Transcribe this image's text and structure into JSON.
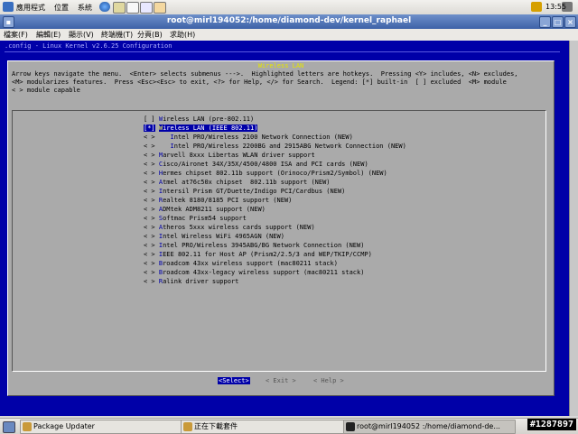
{
  "top_panel": {
    "menus": [
      "應用程式",
      "位置",
      "系統"
    ],
    "clock": "13:55"
  },
  "window": {
    "title": "root@mirl194052:/home/diamond-dev/kernel_raphael"
  },
  "menubar": {
    "items": [
      "檔案(F)",
      "編輯(E)",
      "顯示(V)",
      "終端機(T)",
      "分頁(B)",
      "求助(H)"
    ]
  },
  "terminal": {
    "header": ".config - Linux Kernel v2.6.25 Configuration"
  },
  "dialog": {
    "title": "Wireless LAN",
    "help_lines": [
      "Arrow keys navigate the menu.  <Enter> selects submenus --->.  Highlighted letters are hotkeys.  Pressing <Y> includes, <N> excludes,",
      "<M> modularizes features.  Press <Esc><Esc> to exit, <?> for Help, </> for Search.  Legend: [*] built-in  [ ] excluded  <M> module",
      "< > module capable"
    ],
    "items": [
      {
        "mark": "[ ]",
        "hot": "W",
        "rest": "ireless LAN (pre-802.11)",
        "selected": false
      },
      {
        "mark": "[*]",
        "hot": "W",
        "rest": "ireless LAN (IEEE 802.11)",
        "selected": true
      },
      {
        "mark": "< >",
        "hot": "I",
        "rest": "ntel PRO/Wireless 2100 Network Connection (NEW)",
        "selected": false,
        "indent": true
      },
      {
        "mark": "< >",
        "hot": "I",
        "rest": "ntel PRO/Wireless 2200BG and 2915ABG Network Connection (NEW)",
        "selected": false,
        "indent": true
      },
      {
        "mark": "< >",
        "hot": "M",
        "rest": "arvell 8xxx Libertas WLAN driver support",
        "selected": false
      },
      {
        "mark": "< >",
        "hot": "C",
        "rest": "isco/Aironet 34X/35X/4500/4800 ISA and PCI cards (NEW)",
        "selected": false
      },
      {
        "mark": "< >",
        "hot": "H",
        "rest": "ermes chipset 802.11b support (Orinoco/Prism2/Symbol) (NEW)",
        "selected": false
      },
      {
        "mark": "< >",
        "hot": "A",
        "rest": "tmel at76c50x chipset  802.11b support (NEW)",
        "selected": false
      },
      {
        "mark": "< >",
        "hot": "I",
        "rest": "ntersil Prism GT/Duette/Indigo PCI/Cardbus (NEW)",
        "selected": false
      },
      {
        "mark": "< >",
        "hot": "R",
        "rest": "ealtek 8180/8185 PCI support (NEW)",
        "selected": false
      },
      {
        "mark": "< >",
        "hot": "A",
        "rest": "DMtek ADM8211 support (NEW)",
        "selected": false
      },
      {
        "mark": "< >",
        "hot": "S",
        "rest": "oftmac Prism54 support",
        "selected": false
      },
      {
        "mark": "< >",
        "hot": "A",
        "rest": "theros 5xxx wireless cards support (NEW)",
        "selected": false
      },
      {
        "mark": "< >",
        "hot": "I",
        "rest": "ntel Wireless WiFi 4965AGN (NEW)",
        "selected": false
      },
      {
        "mark": "< >",
        "hot": "I",
        "rest": "ntel PRO/Wireless 3945ABG/BG Network Connection (NEW)",
        "selected": false
      },
      {
        "mark": "< >",
        "hot": "I",
        "rest": "EEE 802.11 for Host AP (Prism2/2.5/3 and WEP/TKIP/CCMP)",
        "selected": false
      },
      {
        "mark": "< >",
        "hot": "B",
        "rest": "roadcom 43xx wireless support (mac80211 stack)",
        "selected": false
      },
      {
        "mark": "< >",
        "hot": "B",
        "rest": "roadcom 43xx-legacy wireless support (mac80211 stack)",
        "selected": false
      },
      {
        "mark": "< >",
        "hot": "R",
        "rest": "alink driver support",
        "selected": false
      }
    ],
    "buttons": {
      "select": "<Select>",
      "exit": "< Exit >",
      "help": "< Help >"
    }
  },
  "taskbar": {
    "tasks": [
      {
        "label": "Package Updater",
        "active": false
      },
      {
        "label": "正在下載套件",
        "active": false
      },
      {
        "label": "root@mirl194052 :/home/diamond-de...",
        "active": true
      }
    ],
    "watermark": "#1287897"
  }
}
